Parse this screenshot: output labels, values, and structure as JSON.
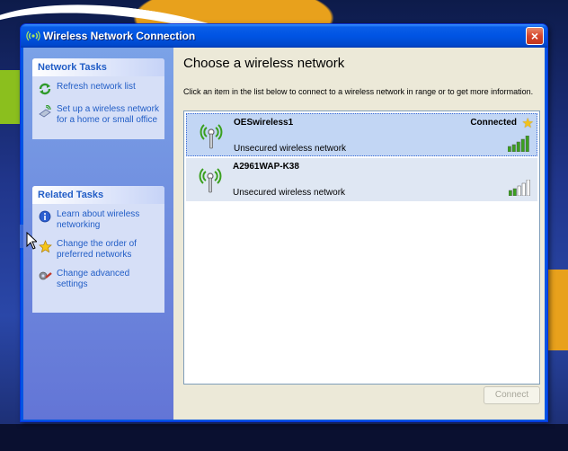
{
  "window": {
    "title": "Wireless Network Connection",
    "close_label": "×"
  },
  "network_tasks": {
    "header": "Network Tasks",
    "items": [
      {
        "label": "Refresh network list",
        "icon": "refresh-icon"
      },
      {
        "label": "Set up a wireless network for a home or small office",
        "icon": "setup-wireless-icon"
      }
    ]
  },
  "related_tasks": {
    "header": "Related Tasks",
    "items": [
      {
        "label": "Learn about wireless networking",
        "icon": "info-icon"
      },
      {
        "label": "Change the order of preferred networks",
        "icon": "star-icon"
      },
      {
        "label": "Change advanced settings",
        "icon": "settings-icon"
      }
    ]
  },
  "main": {
    "title": "Choose a wireless network",
    "description": "Click an item in the list below to connect to a wireless network in range or to get more information.",
    "networks": [
      {
        "name": "OESwireless1",
        "status": "Unsecured wireless network",
        "connection": "Connected",
        "signal_bars": 5
      },
      {
        "name": "A2961WAP-K38",
        "status": "Unsecured wireless network",
        "connection": "",
        "signal_bars": 2
      }
    ],
    "connect_label": "Connect"
  },
  "colors": {
    "accent": "#0054e3",
    "link": "#215dc6",
    "signal_on": "#3aa01e",
    "signal_off": "#ffffff"
  }
}
